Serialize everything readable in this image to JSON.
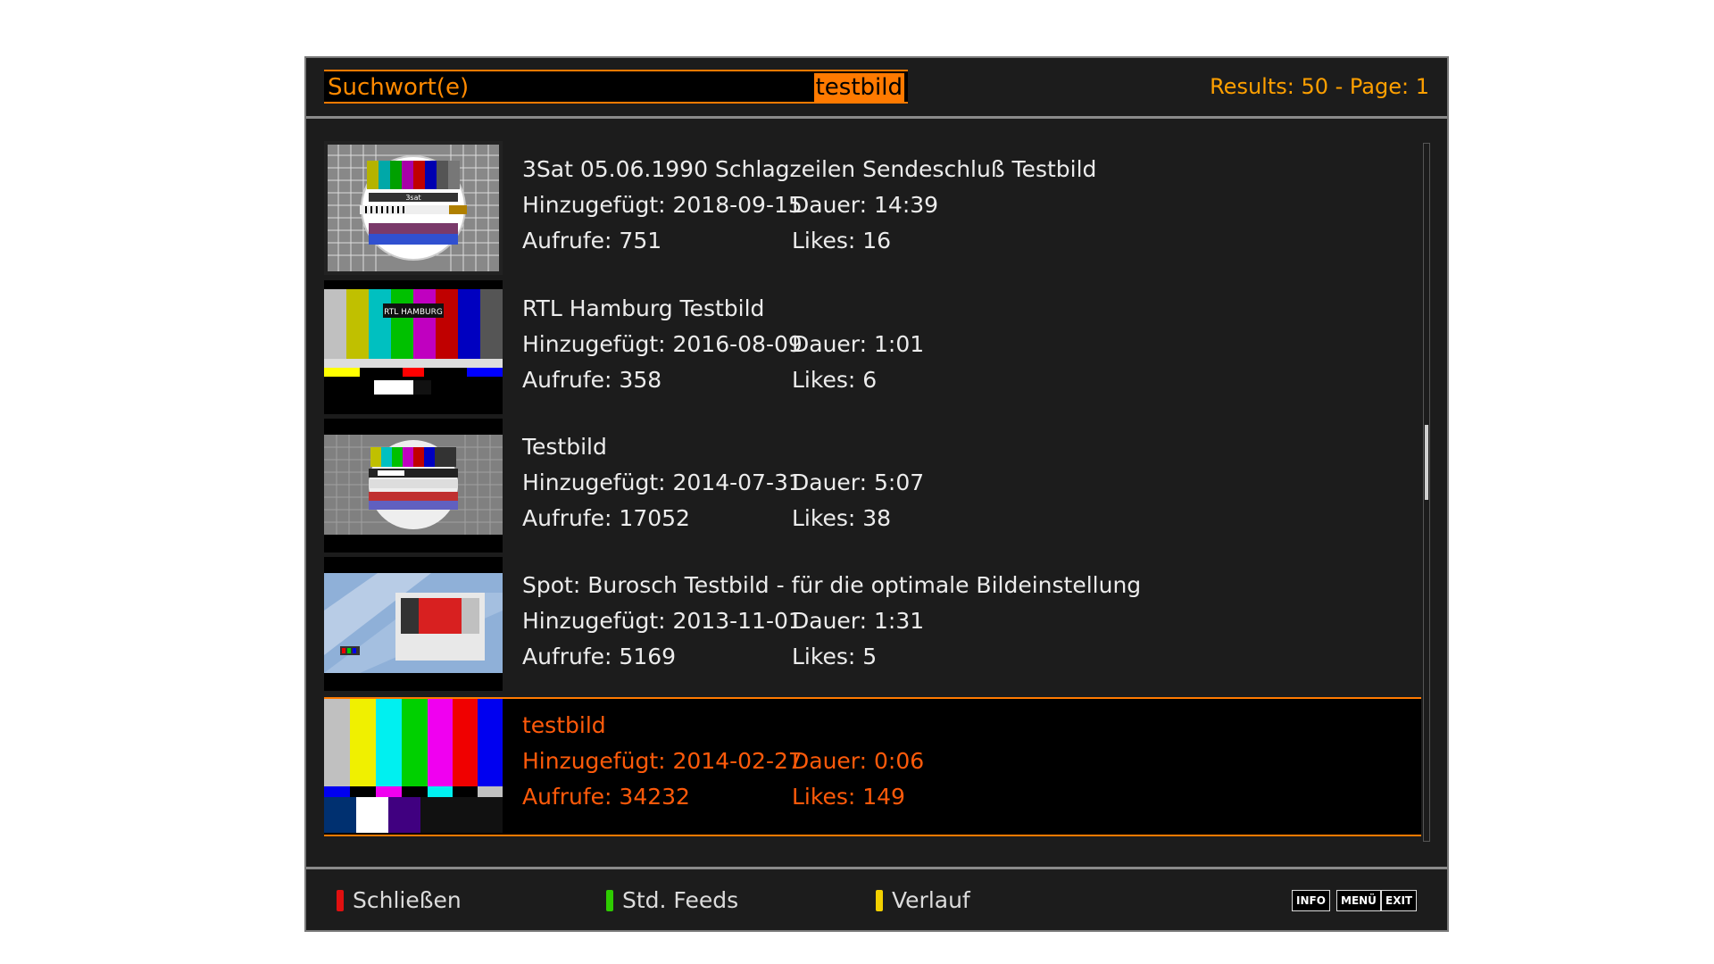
{
  "colors": {
    "accent": "#ff7a00",
    "selected_text": "#ff5a0a",
    "results_text": "#ffa000",
    "panel_bg": "#1c1c1c",
    "red_button": "#e01010",
    "green_button": "#2ecc00",
    "yellow_button": "#f2d000"
  },
  "search": {
    "label": "Suchwort(e)",
    "value": "testbild"
  },
  "results": {
    "text": "Results: 50 - Page: 1"
  },
  "items": [
    {
      "title": "3Sat 05.06.1990 Schlagzeilen Sendeschluß Testbild",
      "added": "Hinzugefügt: 2018-09-15",
      "duration": "Dauer: 14:39",
      "views": "Aufrufe: 751",
      "likes": "Likes: 16",
      "thumbnail": "3sat-testcard-thumbnail",
      "thumb_caption": "3sat"
    },
    {
      "title": "RTL Hamburg Testbild",
      "added": "Hinzugefügt: 2016-08-09",
      "duration": "Dauer: 1:01",
      "views": "Aufrufe: 358",
      "likes": "Likes: 6",
      "thumbnail": "rtl-colorbars-thumbnail",
      "thumb_caption": "RTL HAMBURG"
    },
    {
      "title": "Testbild",
      "added": "Hinzugefügt: 2014-07-31",
      "duration": "Dauer: 5:07",
      "views": "Aufrufe: 17052",
      "likes": "Likes: 38",
      "thumbnail": "testcard-thumbnail"
    },
    {
      "title": "Spot: Burosch Testbild - für die optimale Bildeinstellung",
      "added": "Hinzugefügt: 2013-11-01",
      "duration": "Dauer: 1:31",
      "views": "Aufrufe: 5169",
      "likes": "Likes: 5",
      "thumbnail": "burosch-spot-thumbnail"
    },
    {
      "title": "testbild",
      "added": "Hinzugefügt: 2014-02-27",
      "duration": "Dauer: 0:06",
      "views": "Aufrufe: 34232",
      "likes": "Likes: 149",
      "thumbnail": "smpte-colorbars-thumbnail",
      "selected": true
    }
  ],
  "footer": {
    "red_label": "Schließen",
    "green_label": "Std. Feeds",
    "yellow_label": "Verlauf",
    "info_key": "INFO",
    "menu_key": "MENÜ",
    "exit_key": "EXIT"
  }
}
